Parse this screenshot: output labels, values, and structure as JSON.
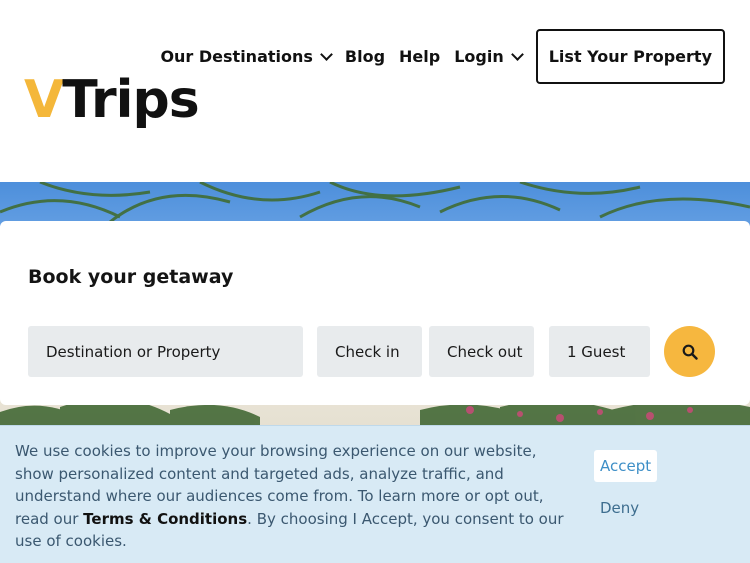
{
  "brand": {
    "logo_v": "V",
    "logo_text": "Trips",
    "accent_color": "#f4b73a"
  },
  "nav": {
    "destinations": "Our Destinations",
    "blog": "Blog",
    "help": "Help",
    "login": "Login",
    "list_property": "List Your Property"
  },
  "booking": {
    "title": "Book your getaway",
    "destination_placeholder": "Destination or Property",
    "check_in": "Check in",
    "check_out": "Check out",
    "guests": "1 Guest",
    "search_icon": "search-icon",
    "search_color": "#f6b73f"
  },
  "cookie": {
    "text_before": "We use cookies to improve your browsing experience on our website, show personalized content and targeted ads, analyze traffic, and understand where our audiences come from. To learn more or opt out, read our ",
    "terms_link": "Terms & Conditions",
    "text_after": ". By choosing I Accept, you consent to our use of cookies.",
    "accept": "Accept",
    "deny": "Deny",
    "background": "#d8eaf5"
  }
}
